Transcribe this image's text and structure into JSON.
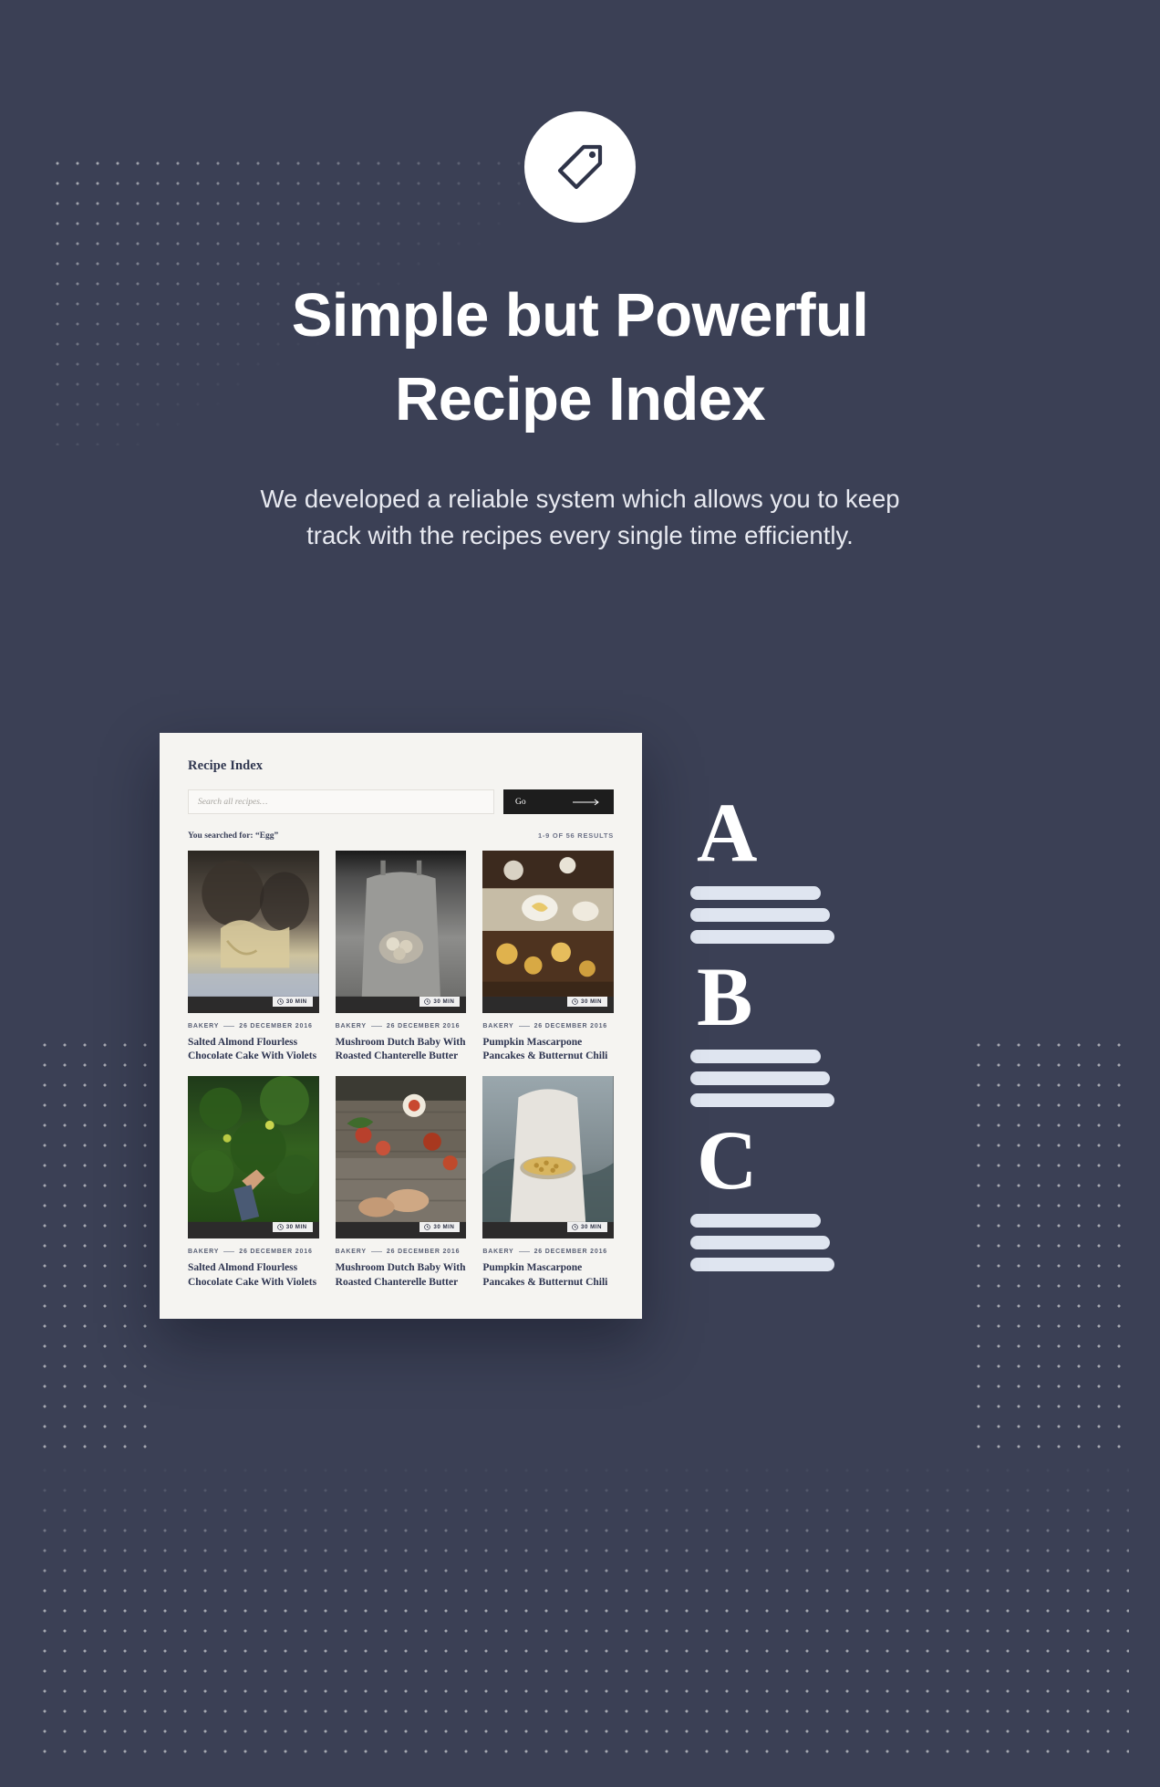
{
  "theme": {
    "background": "#3b4055",
    "card_background": "#f5f4f1",
    "accent_dark": "#1d1d1d",
    "title_color": "#ffffff",
    "heading_color": "#2d3450"
  },
  "hero": {
    "logo_icon": "tag-icon",
    "title_line_1": "Simple but Powerful",
    "title_line_2": "Recipe Index",
    "subtitle_line_1": "We developed a reliable system which allows you to keep",
    "subtitle_line_2": "track with the recipes every single time efficiently."
  },
  "mock": {
    "title": "Recipe Index",
    "search": {
      "placeholder": "Search all recipes…",
      "value": "",
      "button_label": "Go",
      "button_icon": "arrow-right-icon"
    },
    "results": {
      "searched_for": "You searched for: “Egg”",
      "count": "1-9 OF 56 RESULTS"
    },
    "cards": [
      {
        "image_alt": "hands-holding-fresh-pasta",
        "duration": "30 MIN",
        "duration_icon": "clock-icon",
        "category": "BAKERY",
        "date": "26 DECEMBER 2016",
        "title": "Salted Almond Flourless Chocolate Cake With Violets"
      },
      {
        "image_alt": "person-holding-eggs-in-apron",
        "duration": "30 MIN",
        "duration_icon": "clock-icon",
        "category": "BAKERY",
        "date": "26 DECEMBER 2016",
        "title": "Mushroom Dutch Baby With Roasted Chanterelle Butter"
      },
      {
        "image_alt": "table-spread-with-plates-and-pastries",
        "duration": "30 MIN",
        "duration_icon": "clock-icon",
        "category": "BAKERY",
        "date": "26 DECEMBER 2016",
        "title": "Pumpkin Mascarpone Pancakes & Butternut Chili"
      },
      {
        "image_alt": "hand-picking-apple-from-green-tree",
        "duration": "30 MIN",
        "duration_icon": "clock-icon",
        "category": "BAKERY",
        "date": "26 DECEMBER 2016",
        "title": "Salted Almond Flourless Chocolate Cake With Violets"
      },
      {
        "image_alt": "hands-over-rustic-table-with-fruit",
        "duration": "30 MIN",
        "duration_icon": "clock-icon",
        "category": "BAKERY",
        "date": "26 DECEMBER 2016",
        "title": "Mushroom Dutch Baby With Roasted Chanterelle Butter"
      },
      {
        "image_alt": "person-holding-tray-of-nuts",
        "duration": "30 MIN",
        "duration_icon": "clock-icon",
        "category": "BAKERY",
        "date": "26 DECEMBER 2016",
        "title": "Pumpkin Mascarpone Pancakes & Butternut Chili"
      }
    ]
  },
  "alphabet_graphic": {
    "letters": [
      "A",
      "B",
      "C"
    ]
  }
}
